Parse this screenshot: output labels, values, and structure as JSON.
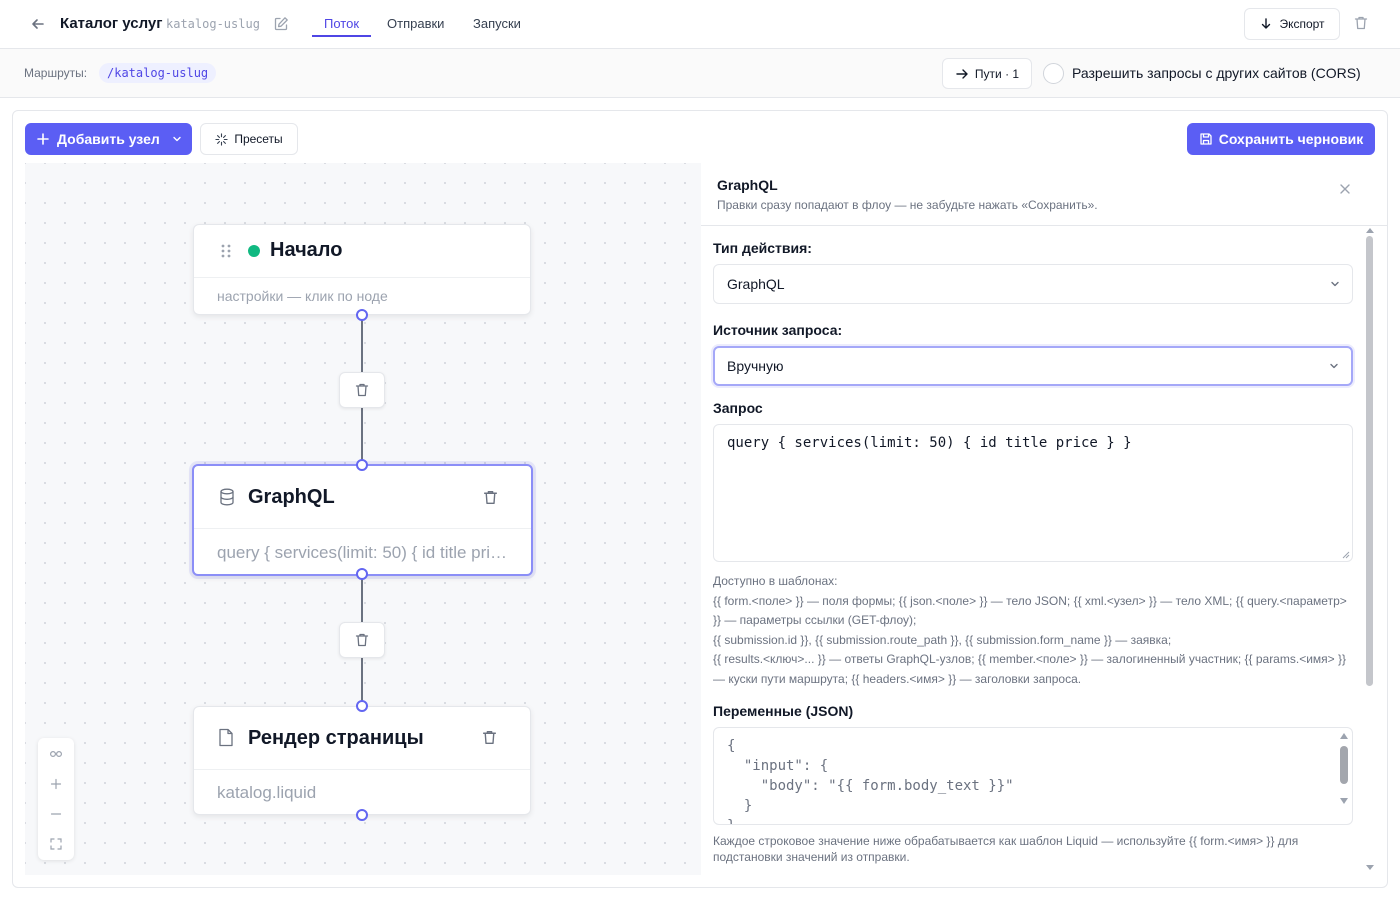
{
  "header": {
    "title": "Каталог услуг",
    "slug": "katalog-uslug",
    "tabs": [
      {
        "label": "Поток",
        "active": true
      },
      {
        "label": "Отправки",
        "active": false
      },
      {
        "label": "Запуски",
        "active": false
      }
    ],
    "export_label": "Экспорт"
  },
  "routes": {
    "label": "Маршруты:",
    "items": [
      "/katalog-uslug"
    ],
    "paths_label": "Пути · 1",
    "cors_label": "Разрешить запросы с других сайтов (CORS)",
    "cors_checked": false
  },
  "toolbar": {
    "add_node_label": "Добавить узел",
    "presets_label": "Пресеты",
    "save_draft_label": "Сохранить черновик"
  },
  "nodes": [
    {
      "title": "Начало",
      "subtitle": "настройки — клик по ноде",
      "icon": "drag-handle-icon",
      "status_color": "#10b981"
    },
    {
      "title": "GraphQL",
      "subtitle": "query { services(limit: 50) { id title price } }",
      "icon": "database-icon",
      "selected": true
    },
    {
      "title": "Рендер страницы",
      "subtitle": "katalog.liquid",
      "icon": "file-icon"
    }
  ],
  "panel": {
    "title": "GraphQL",
    "hint": "Правки сразу попадают в флоу — не забудьте нажать «Сохранить».",
    "action_type_label": "Тип действия:",
    "action_type_value": "GraphQL",
    "source_label": "Источник запроса:",
    "source_value": "Вручную",
    "query_label": "Запрос",
    "query_value": "query { services(limit: 50) { id title price } }",
    "templates_help": [
      "Доступно в шаблонах:",
      "{{ form.<поле> }} — поля формы; {{ json.<поле> }} — тело JSON; {{ xml.<узел> }} — тело XML; {{ query.<параметр> }} — параметры ссылки (GET-флоу);",
      "{{ submission.id }}, {{ submission.route_path }}, {{ submission.form_name }} — заявка;",
      "{{ results.<ключ>... }} — ответы GraphQL-узлов; {{ member.<поле> }} — залогиненный участник; {{ params.<имя> }} — куски пути маршрута; {{ headers.<имя> }} — заголовки запроса."
    ],
    "variables_label": "Переменные (JSON)",
    "variables_lines": [
      "{",
      "  \"input\": {",
      "    \"body\": \"{{ form.body_text }}\"",
      "  }",
      "}"
    ],
    "variables_help": "Каждое строковое значение ниже обрабатывается как шаблон Liquid — используйте {{ form.<имя> }} для подстановки значений из отправки."
  },
  "colors": {
    "accent": "#5b5ef4",
    "status_green": "#10b981",
    "border": "#e5e7eb"
  }
}
